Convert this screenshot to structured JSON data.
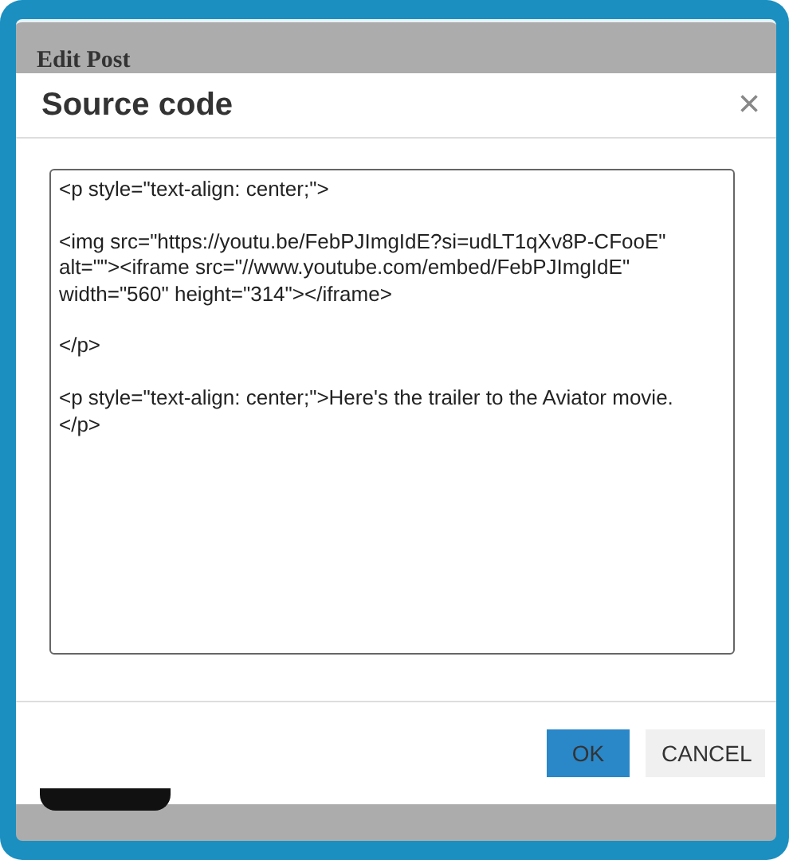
{
  "page": {
    "heading": "Edit Post"
  },
  "dialog": {
    "title": "Source code",
    "close_icon": "×",
    "code": "<p style=\"text-align: center;\">\n\n<img src=\"https://youtu.be/FebPJImgIdE?si=udLT1qXv8P-CFooE\"\nalt=\"\"><iframe src=\"//www.youtube.com/embed/FebPJImgIdE\"\nwidth=\"560\" height=\"314\"></iframe>\n\n</p>\n\n<p style=\"text-align: center;\">Here's the trailer to the Aviator movie.\n</p>",
    "buttons": [
      {
        "label": "OK",
        "kind": "primary"
      },
      {
        "label": "CANCEL",
        "kind": "secondary"
      }
    ]
  }
}
